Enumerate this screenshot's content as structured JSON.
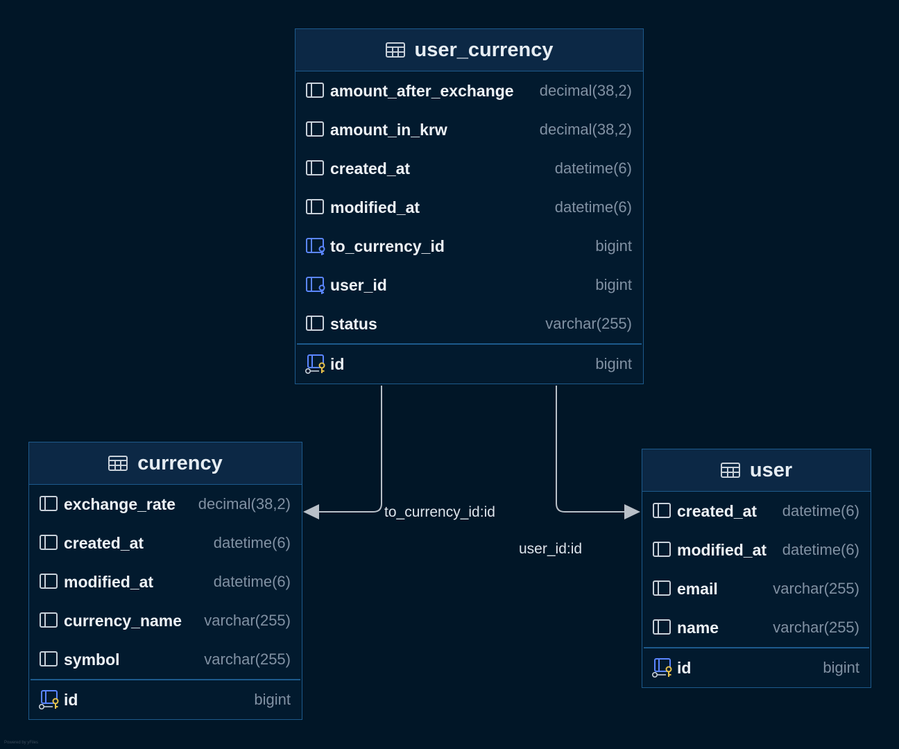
{
  "colors": {
    "background": "#011627",
    "table_border": "#1d5a8c",
    "header_bg": "#0c2845",
    "connector": "#b9c0c8",
    "fk_icon": "#5b86ff",
    "pk_key": "#e8c34a"
  },
  "edges": {
    "to_currency": "to_currency_id:id",
    "to_user": "user_id:id"
  },
  "tables": {
    "user_currency": {
      "name": "user_currency",
      "icon": "table-icon",
      "columns": [
        {
          "name": "amount_after_exchange",
          "type": "decimal(38,2)",
          "icon": "column-icon"
        },
        {
          "name": "amount_in_krw",
          "type": "decimal(38,2)",
          "icon": "column-icon"
        },
        {
          "name": "created_at",
          "type": "datetime(6)",
          "icon": "column-icon"
        },
        {
          "name": "modified_at",
          "type": "datetime(6)",
          "icon": "column-icon"
        },
        {
          "name": "to_currency_id",
          "type": "bigint",
          "icon": "foreign-key-icon"
        },
        {
          "name": "user_id",
          "type": "bigint",
          "icon": "foreign-key-icon"
        },
        {
          "name": "status",
          "type": "varchar(255)",
          "icon": "column-icon"
        }
      ],
      "primary_key": {
        "name": "id",
        "type": "bigint",
        "icon": "primary-key-icon"
      }
    },
    "currency": {
      "name": "currency",
      "icon": "table-icon",
      "columns": [
        {
          "name": "exchange_rate",
          "type": "decimal(38,2)",
          "icon": "column-icon"
        },
        {
          "name": "created_at",
          "type": "datetime(6)",
          "icon": "column-icon"
        },
        {
          "name": "modified_at",
          "type": "datetime(6)",
          "icon": "column-icon"
        },
        {
          "name": "currency_name",
          "type": "varchar(255)",
          "icon": "column-icon"
        },
        {
          "name": "symbol",
          "type": "varchar(255)",
          "icon": "column-icon"
        }
      ],
      "primary_key": {
        "name": "id",
        "type": "bigint",
        "icon": "primary-key-icon"
      }
    },
    "user": {
      "name": "user",
      "icon": "table-icon",
      "columns": [
        {
          "name": "created_at",
          "type": "datetime(6)",
          "icon": "column-icon"
        },
        {
          "name": "modified_at",
          "type": "datetime(6)",
          "icon": "column-icon"
        },
        {
          "name": "email",
          "type": "varchar(255)",
          "icon": "column-icon"
        },
        {
          "name": "name",
          "type": "varchar(255)",
          "icon": "column-icon"
        }
      ],
      "primary_key": {
        "name": "id",
        "type": "bigint",
        "icon": "primary-key-icon"
      }
    }
  },
  "watermark": "Powered by yFiles"
}
